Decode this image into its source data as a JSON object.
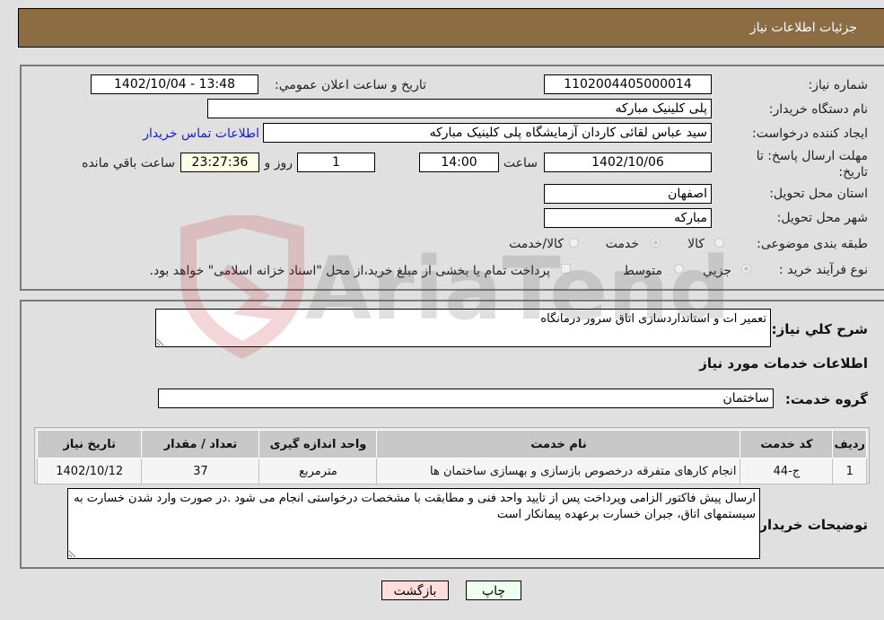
{
  "header": {
    "title": "جزئیات اطلاعات نیاز"
  },
  "form": {
    "need_number": {
      "label": "شماره نیاز:",
      "value": "1102004405000014"
    },
    "announce_datetime": {
      "label": "تاریخ و ساعت اعلان عمومي:",
      "value": "1402/10/04 - 13:48"
    },
    "buyer_org": {
      "label": "نام دستگاه خریدار:",
      "value": "پلی کلینیک مبارکه"
    },
    "requester": {
      "label": "ایجاد کننده درخواست:",
      "value": "سید عباس لقائی کاردان آزمایشگاه پلی کلینیک مبارکه"
    },
    "buyer_contact_link": "اطلاعات تماس خریدار",
    "deadline": {
      "label": "مهلت ارسال پاسخ: تا تاریخ:",
      "date": "1402/10/06",
      "time_label": "ساعت",
      "time": "14:00",
      "days": "1",
      "days_label": "روز و",
      "remaining": "23:27:36",
      "remaining_label": "ساعت باقي مانده"
    },
    "province": {
      "label": "استان محل تحویل:",
      "value": "اصفهان"
    },
    "city": {
      "label": "شهر محل تحویل:",
      "value": "مبارکه"
    },
    "category": {
      "label": "طبقه بندی موضوعی:",
      "options": [
        "کالا",
        "خدمت",
        "کالا/خدمت"
      ],
      "selected": "خدمت"
    },
    "purchase_type": {
      "label": "نوع فرآیند خرید :",
      "options": [
        "جزیي",
        "متوسط"
      ],
      "selected": "جزیي",
      "treasury_note": "پرداخت تمام یا بخشی از مبلغ خرید،از محل \"اسناد خزانه اسلامی\" خواهد بود."
    }
  },
  "description": {
    "label": "شرح کلي نیاز:",
    "value": "تعمیر ات و استانداردسازی اتاق سرور درمانگاه"
  },
  "services": {
    "section_title": "اطلاعات خدمات مورد نیاز",
    "group_label": "گروه خدمت:",
    "group_value": "ساختمان",
    "table": {
      "headers": [
        "ردیف",
        "کد خدمت",
        "نام خدمت",
        "واحد اندازه گیری",
        "تعداد / مقدار",
        "تاریخ نیاز"
      ],
      "rows": [
        [
          "1",
          "ج-44",
          "انجام کارهای متفرقه درخصوص بازسازی و بهسازی ساختمان ها",
          "مترمربع",
          "37",
          "1402/10/12"
        ]
      ]
    }
  },
  "buyer_notes": {
    "label": "توضیحات خریدار:",
    "value": "ارسال پیش فاکتور الزامی وپرداخت پس از تایید واحد فنی و مطابقت با مشخصات درخواستی انجام می شود .در صورت وارد شدن خسارت به سیستمهای اتاق، جبران خسارت برعهده پیمانکار است"
  },
  "buttons": {
    "print": "چاپ",
    "back": "بازگشت"
  },
  "watermark": {
    "text": "AriaTender.neT",
    "colors": {
      "shield": "#c0282d",
      "text": "#555555"
    }
  },
  "colors": {
    "header_bg": "#8c6d43",
    "link": "#1a1ad6",
    "print_bg": "#efffef",
    "back_bg": "#ffdddd",
    "remaining_bg": "#ffffe6"
  }
}
